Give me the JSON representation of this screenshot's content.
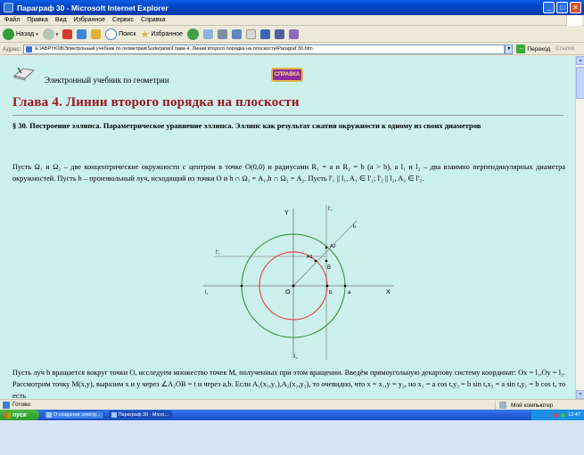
{
  "window": {
    "title": "Параграф 30 - Microsoft Internet Explorer",
    "minimize": "_",
    "maximize": "□",
    "close": "×"
  },
  "menu": [
    "Файл",
    "Правка",
    "Вид",
    "Избранное",
    "Сервис",
    "Справка"
  ],
  "toolbar": {
    "back_label": "Назад",
    "search_label": "Поиск",
    "favorites_label": "Избранное"
  },
  "address": {
    "label": "Адрес:",
    "value": "E:\\ABPYK08\\Электронный учебник по геометрии\\Soderjanie\\Глава 4. Линии второго порядка на плоскости\\Paragraf 30.htm",
    "go_label": "Переход",
    "links_label": "Ссылки"
  },
  "page": {
    "book_title": "Электронный учебник по геометрии",
    "help_button": "СПРАВКА",
    "chapter_title": "Глава 4. Линии второго порядка на плоскости",
    "section_title": "§ 30. Построение эллипса. Параметрическое уравнение эллипса. Эллипс как результат сжатия окружности к одному из своих диаметров",
    "para1": "Пусть Ω₁ и Ω₂ – две концентрические окружности с центром в точке O(0,0) и радиусами R₁ = a и R₂ = b (a > b), a l₁ и l₂ – два взаимно перпендикулярных диаметра окружностей. Пусть h – произвольный луч, исходящий из точки O и h ∩ Ω₁ = A₁,h ∩ Ω₂ = A₂. Пусть l'₁ || l₁, A₁ ∈ l'₁; l'₂ || l₂, A₂ ∈ l'₂.",
    "para2": "Пусть луч h вращается вокруг точки O, исследуем множество точек M, полученных при этом вращении. Введём прямоугольную декартову систему координат: Ox = l₁,Oy = l₂. Рассмотрим точку M(x,y), выразим x и y через ∠A₂OB = t и через a,b. Если A₁(x₁,y₁),A₂(x₂,y₂), то очевидно, что x = x₁,y = y₂, но x₁ = a cos t,y₂ = b sin t,x₂ = a sin t,y₁ = b cos t, то есть"
  },
  "figure": {
    "labels": {
      "y_axis": "Y",
      "x_axis": "X",
      "origin": "O",
      "l1": "l₁",
      "l2": "l₂",
      "l1_prime": "l'₁",
      "l2_prime": "l'₂",
      "h": "h",
      "A1": "A1",
      "A2": "A2",
      "B": "B",
      "b": "b",
      "a": "a"
    },
    "colors": {
      "outer_circle": "#2e8b2e",
      "inner_circle": "#e8444a",
      "lines": "#707070"
    }
  },
  "status": {
    "left": "Готово",
    "zone": "Мой компьютер"
  },
  "taskbar": {
    "start": "пуск",
    "items": [
      "О создании электр...",
      "Параграф 30 - Micro..."
    ],
    "clock": "13:47"
  }
}
